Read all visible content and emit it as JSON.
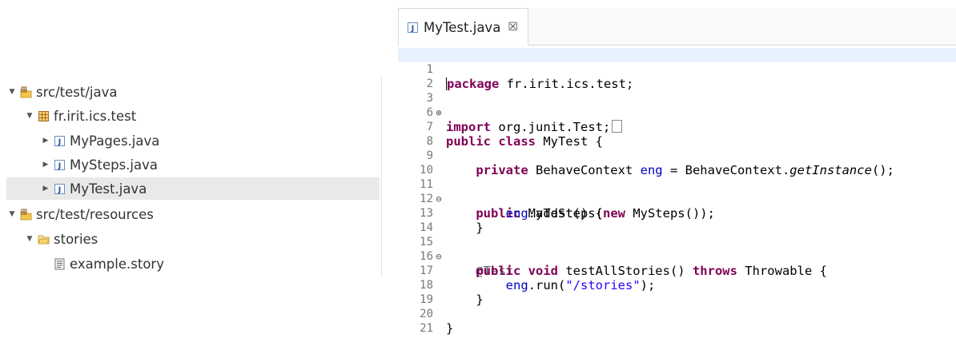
{
  "tree": {
    "items": [
      {
        "label": "src/test/java",
        "icon": "source-folder-icon",
        "expanded": true
      },
      {
        "label": "fr.irit.ics.test",
        "icon": "package-icon",
        "expanded": true
      },
      {
        "label": "MyPages.java",
        "icon": "java-file-icon",
        "expanded": false
      },
      {
        "label": "MySteps.java",
        "icon": "java-file-icon",
        "expanded": false
      },
      {
        "label": "MyTest.java",
        "icon": "java-file-icon",
        "expanded": false,
        "selected": true
      },
      {
        "label": "src/test/resources",
        "icon": "source-folder-icon",
        "expanded": true
      },
      {
        "label": "stories",
        "icon": "folder-icon",
        "expanded": true
      },
      {
        "label": "example.story",
        "icon": "text-file-icon"
      }
    ]
  },
  "editor": {
    "tab_label": "MyTest.java",
    "tab_close": "☒",
    "line_numbers": [
      "1",
      "2",
      "3",
      "6",
      "7",
      "8",
      "9",
      "10",
      "11",
      "12",
      "13",
      "14",
      "15",
      "16",
      "17",
      "18",
      "19",
      "20",
      "21"
    ],
    "code": {
      "l1_kw": "package",
      "l1_rest": " fr.irit.ics.test;",
      "l3_kw": "import",
      "l3_rest": " org.junit.Test;",
      "l7_kw": "public class",
      "l7_rest": " MyTest {",
      "l9_kw": "private",
      "l9_type": " BehaveContext ",
      "l9_field": "eng",
      "l9_mid": " = BehaveContext.",
      "l9_method": "getInstance",
      "l9_end": "();",
      "l11_kw": "public",
      "l11_rest": " MyTest() {",
      "l12_field": "eng",
      "l12_mid": ".addSteps(",
      "l12_kw": "new",
      "l12_end": " MySteps());",
      "l13": "}",
      "l15": "@Test",
      "l16_kw": "public void",
      "l16_mid": " testAllStories() ",
      "l16_kw2": "throws",
      "l16_end": " Throwable {",
      "l17_field": "eng",
      "l17_mid": ".run(",
      "l17_str": "\"/stories\"",
      "l17_end": ");",
      "l18": "}",
      "l20": "}"
    }
  },
  "colors": {
    "keyword": "#7f0055",
    "field": "#0000c0",
    "string": "#2a00ff",
    "annotation": "#646464",
    "current_line": "#e8f2fe",
    "selected_row": "#e9e9e9"
  }
}
